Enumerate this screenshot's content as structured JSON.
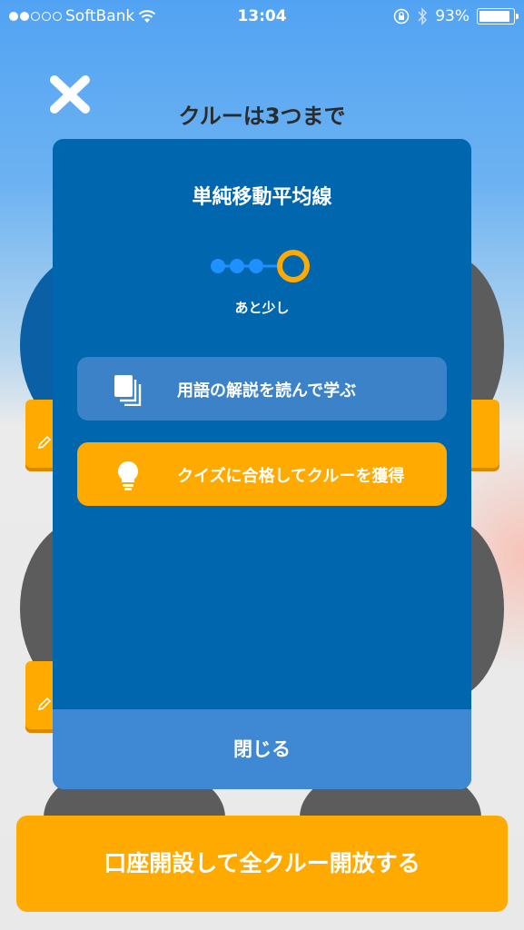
{
  "status_bar": {
    "carrier": "SoftBank",
    "time": "13:04",
    "battery_percent": "93%",
    "battery_level": 0.93,
    "signal_bars": 2,
    "icons": [
      "wifi-icon",
      "orientation-lock-icon",
      "bluetooth-icon",
      "battery-icon"
    ]
  },
  "background_page": {
    "title": "クルーは3つまで",
    "close_icon": "close-icon"
  },
  "modal": {
    "title": "単純移動平均線",
    "progress": {
      "filled_steps": 3,
      "total_steps": 4
    },
    "progress_caption": "あと少し",
    "actions": [
      {
        "label": "用語の解説を読んで学ぶ",
        "icon": "documents-icon"
      },
      {
        "label": "クイズに合格してクルーを獲得",
        "icon": "lightbulb-icon"
      }
    ],
    "close_label": "閉じる"
  },
  "cta": {
    "label": "口座開設して全クルー開放する"
  },
  "colors": {
    "modal_bg": "#0066ad",
    "learn_button": "#3b82c9",
    "accent_orange": "#ffaa00",
    "footer_bar": "#3e88d4",
    "progress_dot": "#1e90ff"
  }
}
